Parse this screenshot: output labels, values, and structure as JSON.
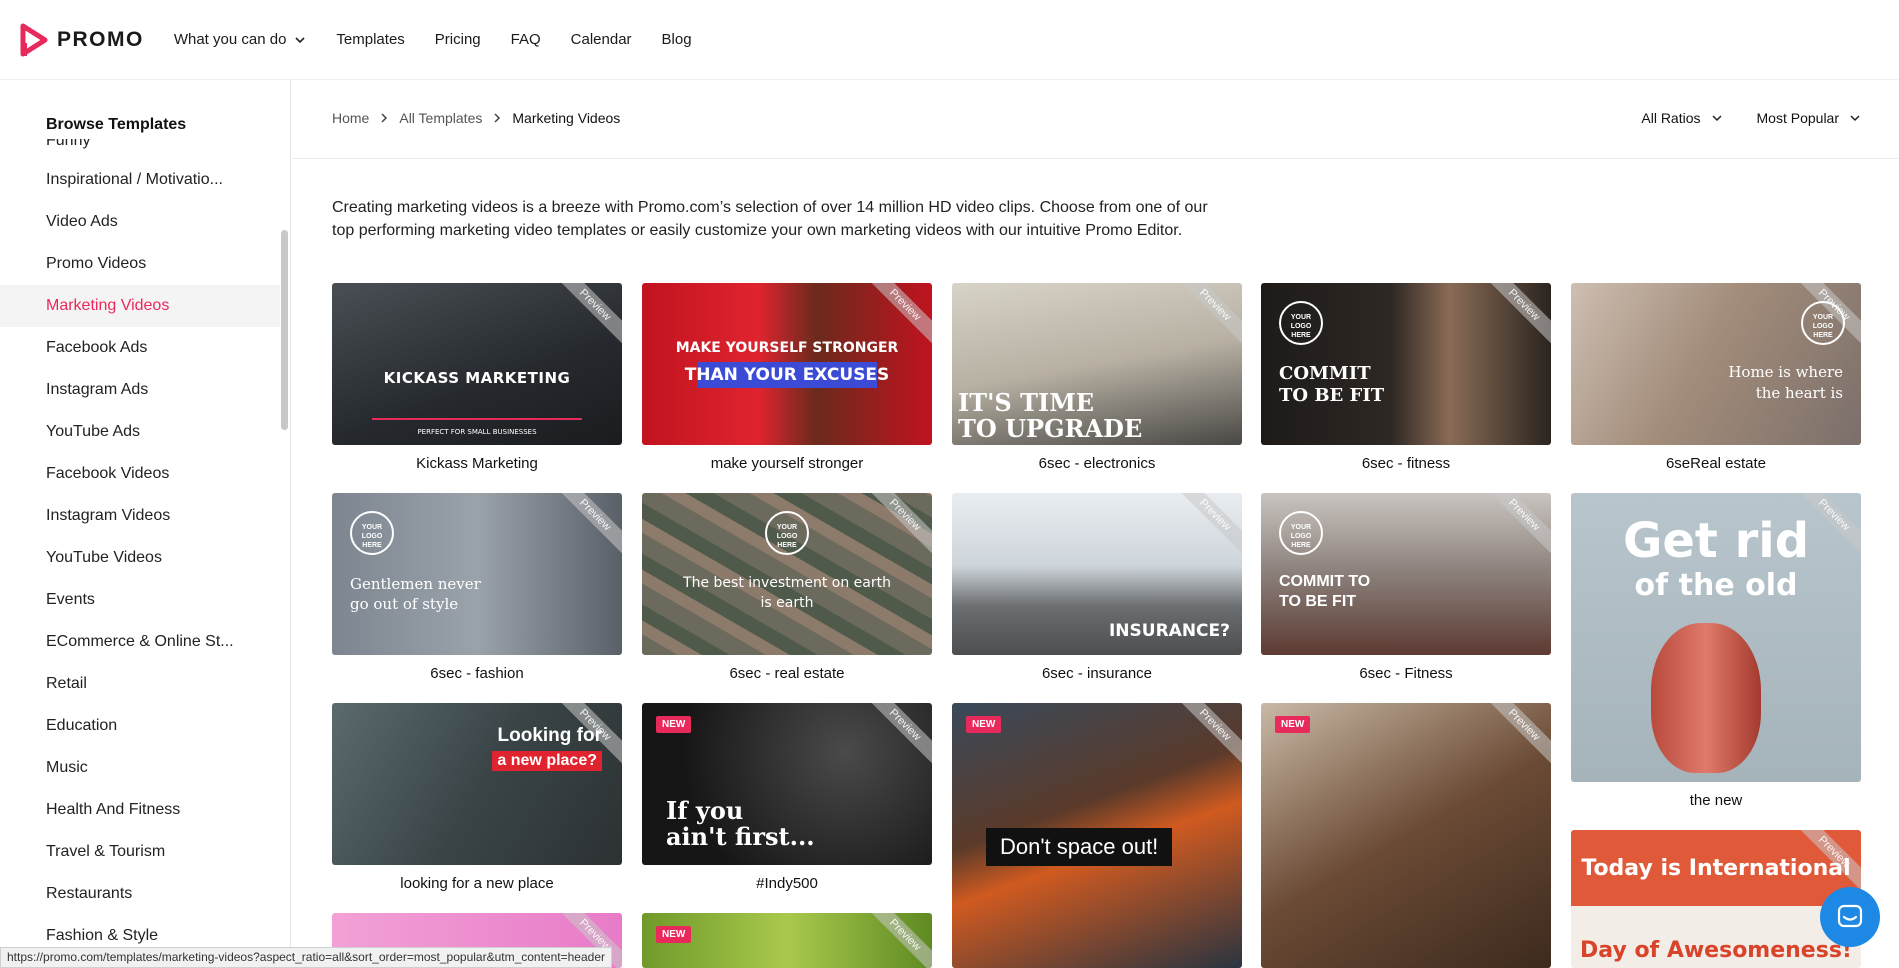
{
  "header": {
    "logo_text": "PROMO",
    "nav": [
      {
        "label": "What you can do",
        "has_dropdown": true
      },
      {
        "label": "Templates"
      },
      {
        "label": "Pricing"
      },
      {
        "label": "FAQ"
      },
      {
        "label": "Calendar"
      },
      {
        "label": "Blog"
      }
    ]
  },
  "sidebar": {
    "title": "Browse Templates",
    "partial_item": "Funny",
    "items": [
      {
        "label": "Inspirational / Motivatio..."
      },
      {
        "label": "Video Ads"
      },
      {
        "label": "Promo Videos"
      },
      {
        "label": "Marketing Videos",
        "active": true
      },
      {
        "label": "Facebook Ads"
      },
      {
        "label": "Instagram Ads"
      },
      {
        "label": "YouTube Ads"
      },
      {
        "label": "Facebook Videos"
      },
      {
        "label": "Instagram Videos"
      },
      {
        "label": "YouTube Videos"
      },
      {
        "label": "Events"
      },
      {
        "label": "ECommerce & Online St..."
      },
      {
        "label": "Retail"
      },
      {
        "label": "Education"
      },
      {
        "label": "Music"
      },
      {
        "label": "Health And Fitness"
      },
      {
        "label": "Travel & Tourism"
      },
      {
        "label": "Restaurants"
      },
      {
        "label": "Fashion & Style"
      }
    ]
  },
  "breadcrumb": {
    "home": "Home",
    "all": "All Templates",
    "current": "Marketing Videos"
  },
  "filters": {
    "ratio": "All Ratios",
    "sort": "Most Popular"
  },
  "intro": "Creating marketing videos is a breeze with Promo.com’s selection of over 14 million HD video clips. Choose from one of our top performing marketing video templates or easily customize your own marketing videos with our intuitive Promo Editor.",
  "cards": [
    {
      "caption": "Kickass Marketing",
      "overlay": "KICKASS MARKETING",
      "sub": "PERFECT FOR SMALL BUSINESSES"
    },
    {
      "caption": "make yourself stronger",
      "overlay": "MAKE YOURSELF STRONGER",
      "overlay2": "THAN YOUR EXCUSES"
    },
    {
      "caption": "6sec - electronics",
      "overlay": "IT'S TIME",
      "overlay2": "TO UPGRADE"
    },
    {
      "caption": "6sec - fitness",
      "overlay": "COMMIT",
      "overlay2": "TO BE FIT",
      "logo": "YOUR LOGO HERE"
    },
    {
      "caption": "6seReal estate",
      "overlay": "Home is where",
      "overlay2": "the heart is",
      "logo": "YOUR LOGO HERE"
    },
    {
      "caption": "6sec - fashion",
      "overlay": "Gentlemen never",
      "overlay2": "go out of style",
      "logo": "YOUR LOGO HERE"
    },
    {
      "caption": "6sec - real estate",
      "overlay": "The best investment on earth",
      "overlay2": "is earth",
      "logo": "YOUR LOGO HERE"
    },
    {
      "caption": "6sec - insurance",
      "overlay": "INSURANCE?"
    },
    {
      "caption": "6sec - Fitness",
      "overlay": "COMMIT TO",
      "overlay2": "TO BE FIT",
      "logo": "YOUR LOGO HERE"
    },
    {
      "caption": "the new",
      "overlay": "Get rid",
      "overlay2": "of the old"
    },
    {
      "caption": "looking for a new place",
      "overlay": "Looking for",
      "overlay2": "a new place?"
    },
    {
      "caption": "#Indy500",
      "overlay": "If you",
      "overlay2": "ain't first...",
      "badge": "NEW"
    },
    {
      "caption": "",
      "overlay": "Don't space out!",
      "badge": "NEW"
    },
    {
      "caption": "",
      "badge": "NEW"
    },
    {
      "caption": "",
      "overlay": "Today is International",
      "overlay2": "Day of Awesomeness!"
    },
    {
      "caption": ""
    },
    {
      "caption": "",
      "badge": "NEW"
    }
  ],
  "preview_label": "Preview",
  "status_url": "https://promo.com/templates/marketing-videos?aspect_ratio=all&sort_order=most_popular&utm_content=header",
  "colors": {
    "accent": "#e8295c",
    "chat": "#1e88e5"
  }
}
